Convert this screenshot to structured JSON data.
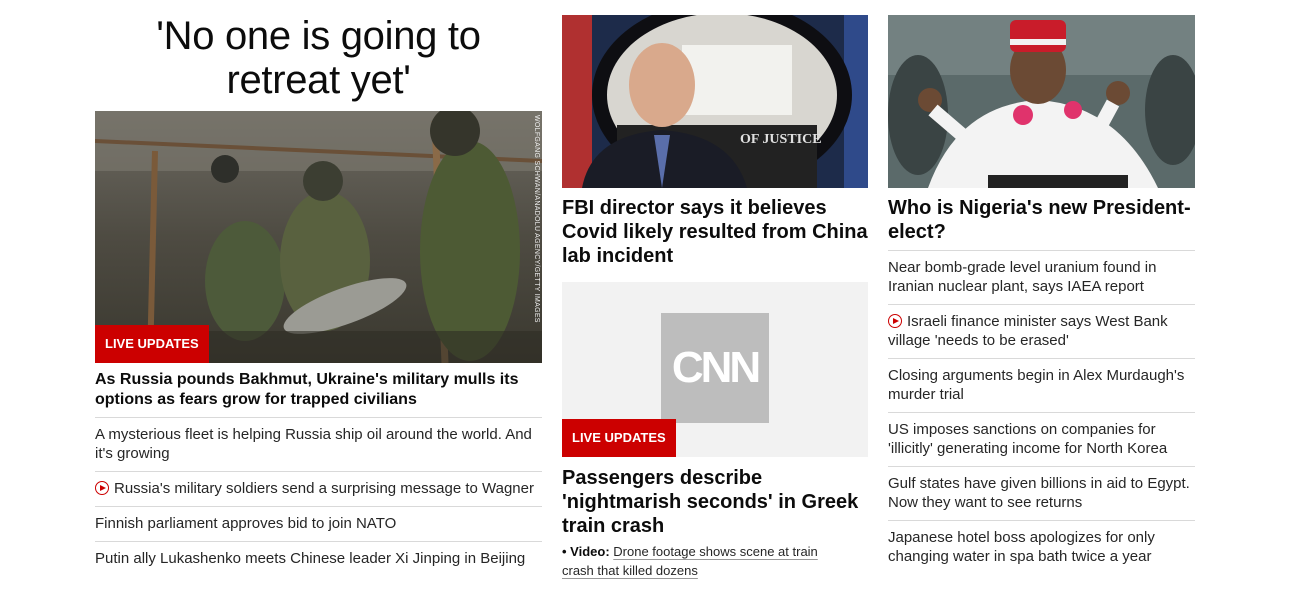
{
  "column1": {
    "big_headline": "'No one is going to retreat yet'",
    "image_credit": "WOLFGANG SCHWAN/ANADOLU AGENCY/GETTY IMAGES",
    "badge": "LIVE UPDATES",
    "headline": "As Russia pounds Bakhmut, Ukraine's military mulls its options as fears grow for trapped civilians",
    "links": [
      {
        "text": "A mysterious fleet is helping Russia ship oil around the world. And it's growing",
        "video": false
      },
      {
        "text": "Russia's military soldiers send a surprising message to Wagner",
        "video": true
      },
      {
        "text": "Finnish parliament approves bid to join NATO",
        "video": false
      },
      {
        "text": "Putin ally Lukashenko meets Chinese leader Xi Jinping in Beijing",
        "video": false
      }
    ]
  },
  "column2": {
    "story1": {
      "seal_text": "OF JUSTICE",
      "headline": "FBI director says it believes Covid likely resulted from China lab incident"
    },
    "story2": {
      "logo_text": "CNN",
      "badge": "LIVE UPDATES",
      "headline": "Passengers describe 'nightmarish seconds' in Greek train crash",
      "video_label": "• Video:",
      "video_link": "Drone footage shows scene at train crash that killed dozens"
    }
  },
  "column3": {
    "headline": "Who is Nigeria's new President-elect?",
    "links": [
      {
        "text": "Near bomb-grade level uranium found in Iranian nuclear plant, says IAEA report",
        "video": false
      },
      {
        "text": "Israeli finance minister says West Bank village 'needs to be erased'",
        "video": true
      },
      {
        "text": "Closing arguments begin in Alex Murdaugh's murder trial",
        "video": false
      },
      {
        "text": "US imposes sanctions on companies for 'illicitly' generating income for North Korea",
        "video": false
      },
      {
        "text": "Gulf states have given billions in aid to Egypt. Now they want to see returns",
        "video": false
      },
      {
        "text": "Japanese hotel boss apologizes for only changing water in spa bath twice a year",
        "video": false
      }
    ]
  },
  "colors": {
    "accent": "#cc0000",
    "text": "#0c0c0c",
    "divider": "#d9d9d9"
  }
}
